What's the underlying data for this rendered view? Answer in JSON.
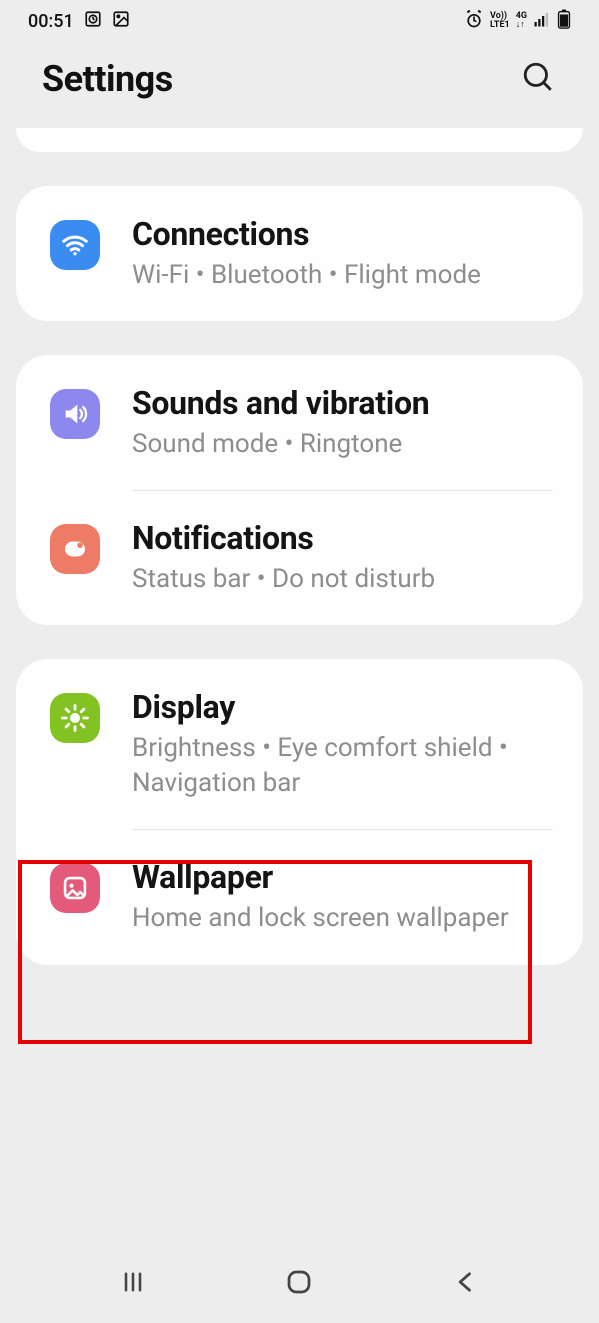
{
  "status": {
    "time": "00:51",
    "net_label": "Vo))",
    "lte_label": "LTE1",
    "gen_label": "4G"
  },
  "header": {
    "title": "Settings"
  },
  "groups": [
    {
      "items": [
        {
          "icon": "wifi",
          "icon_bg": "#3b8cf0",
          "title": "Connections",
          "sub": "Wi-Fi  •  Bluetooth  •  Flight mode"
        }
      ]
    },
    {
      "items": [
        {
          "icon": "sound",
          "icon_bg": "#8c88ed",
          "title": "Sounds and vibration",
          "sub": "Sound mode  •  Ringtone"
        },
        {
          "icon": "notif",
          "icon_bg": "#ed7b65",
          "title": "Notifications",
          "sub": "Status bar  •  Do not disturb"
        }
      ]
    },
    {
      "items": [
        {
          "icon": "brightness",
          "icon_bg": "#82c323",
          "title": "Display",
          "sub": "Brightness  •  Eye comfort shield  •  Navigation bar",
          "highlighted": true
        },
        {
          "icon": "wallpaper",
          "icon_bg": "#e45a7b",
          "title": "Wallpaper",
          "sub": "Home and lock screen wallpaper"
        }
      ]
    }
  ]
}
